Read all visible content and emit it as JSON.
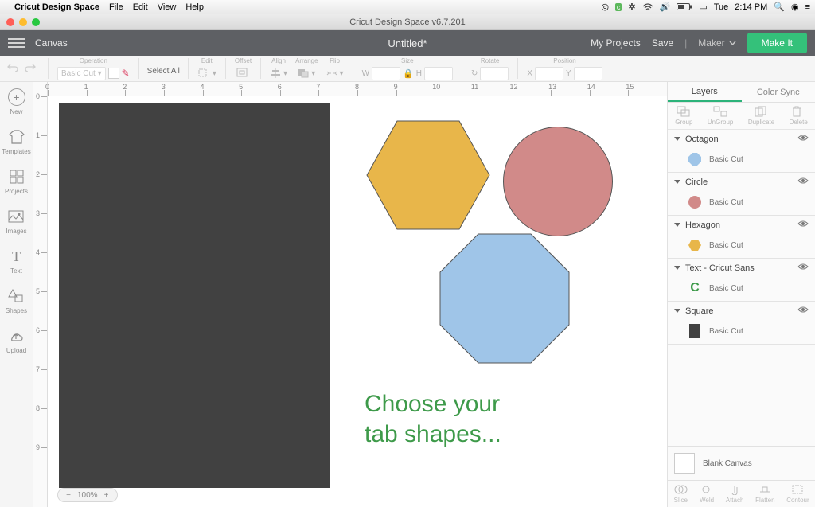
{
  "mac": {
    "app_name": "Cricut Design Space",
    "menus": [
      "File",
      "Edit",
      "View",
      "Help"
    ],
    "day": "Tue",
    "time": "2:14 PM"
  },
  "window": {
    "title": "Cricut Design Space  v6.7.201"
  },
  "topbar": {
    "canvas_label": "Canvas",
    "doc_name": "Untitled*",
    "my_projects": "My Projects",
    "save": "Save",
    "machine": "Maker",
    "make_it": "Make It"
  },
  "propbar": {
    "operation_lbl": "Operation",
    "operation_val": "Basic Cut",
    "select_all": "Select All",
    "edit_lbl": "Edit",
    "offset_lbl": "Offset",
    "align_lbl": "Align",
    "arrange_lbl": "Arrange",
    "flip_lbl": "Flip",
    "size_lbl": "Size",
    "size_w": "W",
    "size_h": "H",
    "rotate_lbl": "Rotate",
    "position_lbl": "Position",
    "pos_x": "X",
    "pos_y": "Y"
  },
  "rail": {
    "new": "New",
    "templates": "Templates",
    "projects": "Projects",
    "images": "Images",
    "text": "Text",
    "shapes": "Shapes",
    "upload": "Upload"
  },
  "ruler_h": [
    "0",
    "1",
    "2",
    "3",
    "4",
    "5",
    "6",
    "7",
    "8",
    "9",
    "10",
    "11",
    "12",
    "13",
    "14",
    "15"
  ],
  "ruler_v": [
    "0",
    "1",
    "2",
    "3",
    "4",
    "5",
    "6",
    "7",
    "8",
    "9"
  ],
  "canvas": {
    "text_line1": "Choose your",
    "text_line2": "tab shapes...",
    "zoom": "100%"
  },
  "panel": {
    "tab_layers": "Layers",
    "tab_colorsync": "Color Sync",
    "ops": {
      "group": "Group",
      "ungroup": "UnGroup",
      "duplicate": "Duplicate",
      "delete": "Delete"
    },
    "layers": [
      {
        "name": "Octagon",
        "cut": "Basic Cut",
        "thumb": "octagon",
        "color": "#9fc5e8"
      },
      {
        "name": "Circle",
        "cut": "Basic Cut",
        "thumb": "circle",
        "color": "#d18a89"
      },
      {
        "name": "Hexagon",
        "cut": "Basic Cut",
        "thumb": "hexagon",
        "color": "#e8b64a"
      },
      {
        "name": "Text - Cricut Sans",
        "cut": "Basic Cut",
        "thumb": "letterC",
        "color": "#3e9a4a"
      },
      {
        "name": "Square",
        "cut": "Basic Cut",
        "thumb": "square",
        "color": "#414141"
      }
    ],
    "blank": "Blank Canvas",
    "bottom_ops": {
      "slice": "Slice",
      "weld": "Weld",
      "attach": "Attach",
      "flatten": "Flatten",
      "contour": "Contour"
    }
  }
}
